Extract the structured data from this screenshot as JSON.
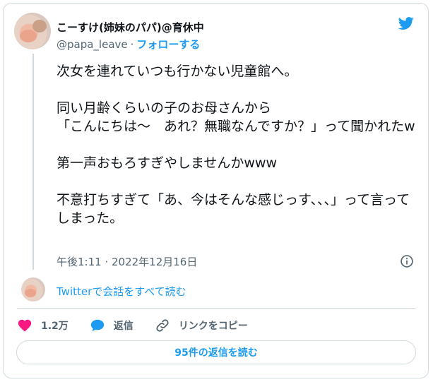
{
  "author": {
    "display_name": "こーすけ(姉妹のパパ)@育休中",
    "handle": "@papa_leave",
    "separator": "·",
    "follow_label": "フォローする"
  },
  "icons": {
    "brand": "twitter-bird-icon",
    "info": "info-icon",
    "like": "heart-icon",
    "reply": "speech-bubble-icon",
    "copy_link": "link-icon"
  },
  "colors": {
    "accent": "#1d9bf0",
    "like": "#f91880",
    "muted_text": "#536471",
    "border": "#cfd9de"
  },
  "tweet": {
    "text": "次女を連れていつも行かない児童館へ。\n\n同い月齢くらいの子のお母さんから\n「こんにちは〜　あれ？無職なんですか？」って聞かれたw\n\n第一声おもろすぎやしませんかwww\n\n不意打ちすぎて「あ、今はそんな感じっす、、、」って言ってしまった。",
    "timestamp": "午後1:11 · 2022年12月16日"
  },
  "thread": {
    "read_label": "Twitterで会話をすべて読む"
  },
  "actions": {
    "like_count": "1.2万",
    "reply_label": "返信",
    "copy_link_label": "リンクをコピー"
  },
  "footer": {
    "read_replies_label": "95件の返信を読む"
  }
}
